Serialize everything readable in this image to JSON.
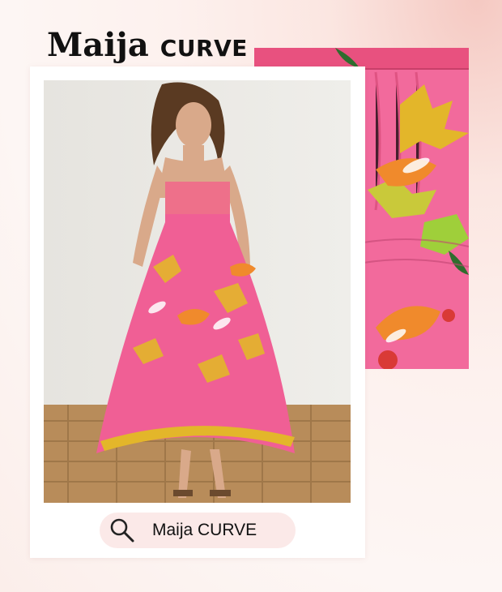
{
  "title": {
    "brand": "Maija",
    "sub": "CURVE"
  },
  "search": {
    "label": "Maija CURVE",
    "icon": "search-icon"
  },
  "images": {
    "main": "model-in-pink-tropical-maxi-dress",
    "detail": "dress-print-closeup"
  },
  "colors": {
    "background": "#fdf1ee",
    "dress_pink": "#f05f95",
    "pill": "#fbe9e8",
    "text": "#111111"
  }
}
